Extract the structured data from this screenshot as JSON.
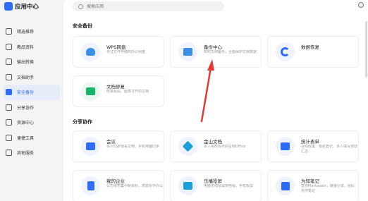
{
  "app": {
    "title": "应用中心"
  },
  "search": {
    "placeholder": "搜索应用"
  },
  "sidebar": {
    "items": [
      {
        "label": "精选推荐",
        "icon": "star-icon"
      },
      {
        "label": "教品资料",
        "icon": "doc-icon"
      },
      {
        "label": "输出转换",
        "icon": "convert-icon"
      },
      {
        "label": "文档助手",
        "icon": "assistant-icon"
      },
      {
        "label": "安全备份",
        "icon": "shield-icon",
        "active": true
      },
      {
        "label": "分享协作",
        "icon": "share-icon"
      },
      {
        "label": "资源中心",
        "icon": "resource-icon"
      },
      {
        "label": "便捷工具",
        "icon": "tool-icon"
      },
      {
        "label": "其他服务",
        "icon": "more-icon"
      }
    ]
  },
  "sections": [
    {
      "title": "安全备份"
    },
    {
      "title": "分享协作"
    }
  ],
  "cards": [
    {
      "title": "WPS网盘",
      "desc": "专注文件存储的办公网盘",
      "icon": "cloud-icon",
      "color": "#3a8ee6"
    },
    {
      "title": "备份中心",
      "desc": "实时文档备份，全面保护文档数据",
      "icon": "folder-icon",
      "color": "#3a8ee6"
    },
    {
      "title": "数据恢复",
      "desc": "",
      "icon": "g-icon",
      "color": "#2f6bff"
    },
    {
      "title": "文档修复",
      "desc": "修复乱码、图表打开的文档",
      "icon": "repair-icon",
      "color": "#19b36b"
    },
    {
      "title": "会议",
      "desc": "多人同步观看文档、手机电脑同步",
      "icon": "video-icon",
      "color": "#2f6bff"
    },
    {
      "title": "金山文档",
      "desc": "多人实时协作的在线Office",
      "icon": "layers-icon",
      "color": "#1aa0d8"
    },
    {
      "title": "统计表单",
      "desc": "在线收集、报名登记、多人填写自动汇总",
      "icon": "form-icon",
      "color": "#2f6bff"
    },
    {
      "title": "我的企业",
      "desc": "公司事务集中制资料，高效协作办公",
      "icon": "building-icon",
      "color": "#2f6bff"
    },
    {
      "title": "乐播投屏",
      "desc": "电脑无线投屏到电视，手机投屏",
      "icon": "cast-icon",
      "color": "#1aa0d8"
    },
    {
      "title": "为知笔记",
      "desc": "支持Markdown，链接分享，团队协作笔记",
      "icon": "w-icon",
      "color": "#2f6bff"
    }
  ],
  "colors": {
    "accent": "#2f6bff",
    "annotation_arrow": "#e53935"
  }
}
